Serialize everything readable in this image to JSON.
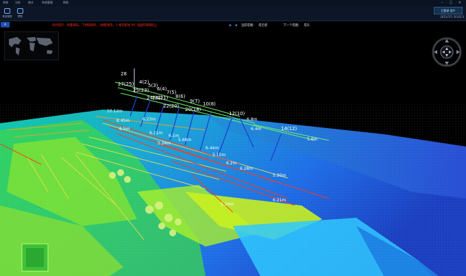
{
  "menu": {
    "items": [
      "系统",
      "分析",
      "统计",
      "系统管理",
      "帮助"
    ],
    "minimize_icon": "minimize-icon",
    "maximize_icon": "maximize-icon",
    "close_icon": "close-icon"
  },
  "toolbar": {
    "tools": [
      {
        "label": "安全检查",
        "icon": "safety-check-icon"
      },
      {
        "label": "预览",
        "icon": "preview-icon"
      }
    ],
    "login_label": "已登录 用户",
    "datetime": "2021/7/1 16:02:3"
  },
  "strip": {
    "tag": "A",
    "warning": "危险提示：附着缺陷，下相缺陷杆，1根距离等，3 相近距地 PIC 电面积隐缺陷上",
    "current_tower_label": "当前塔图：",
    "current_tower_value": "塔全部",
    "next_tower_label": "下一个塔图：",
    "next_tower_value": "塔头"
  },
  "scene": {
    "tower_labels": [
      "28",
      "27(25)",
      "4(2)",
      "25(23)",
      "5(3)",
      "6(4)",
      "24(22)",
      "7(5)",
      "23(21)",
      "8(6)",
      "22(20)",
      "9(7)",
      "10(8)",
      "20(18)",
      "12(10)",
      "14(12)"
    ],
    "span_labels": [
      "10.12m",
      "8.45m",
      "6.5m",
      "6.23m",
      "6.21m",
      "5.24m",
      "6.1m",
      "5.68m",
      "6.44m",
      "5.15m",
      "6.2m",
      "6.28m",
      "5.30m",
      "6.21m",
      "5.24m",
      "6.8m",
      "6.4m",
      "5.6m"
    ],
    "colors": {
      "low": "#1f64e0",
      "mid": "#2ec3b0",
      "high": "#8fef2a",
      "peak": "#ff3a1a",
      "line": "#6ff06a",
      "wire": "#1f3fd0"
    }
  }
}
